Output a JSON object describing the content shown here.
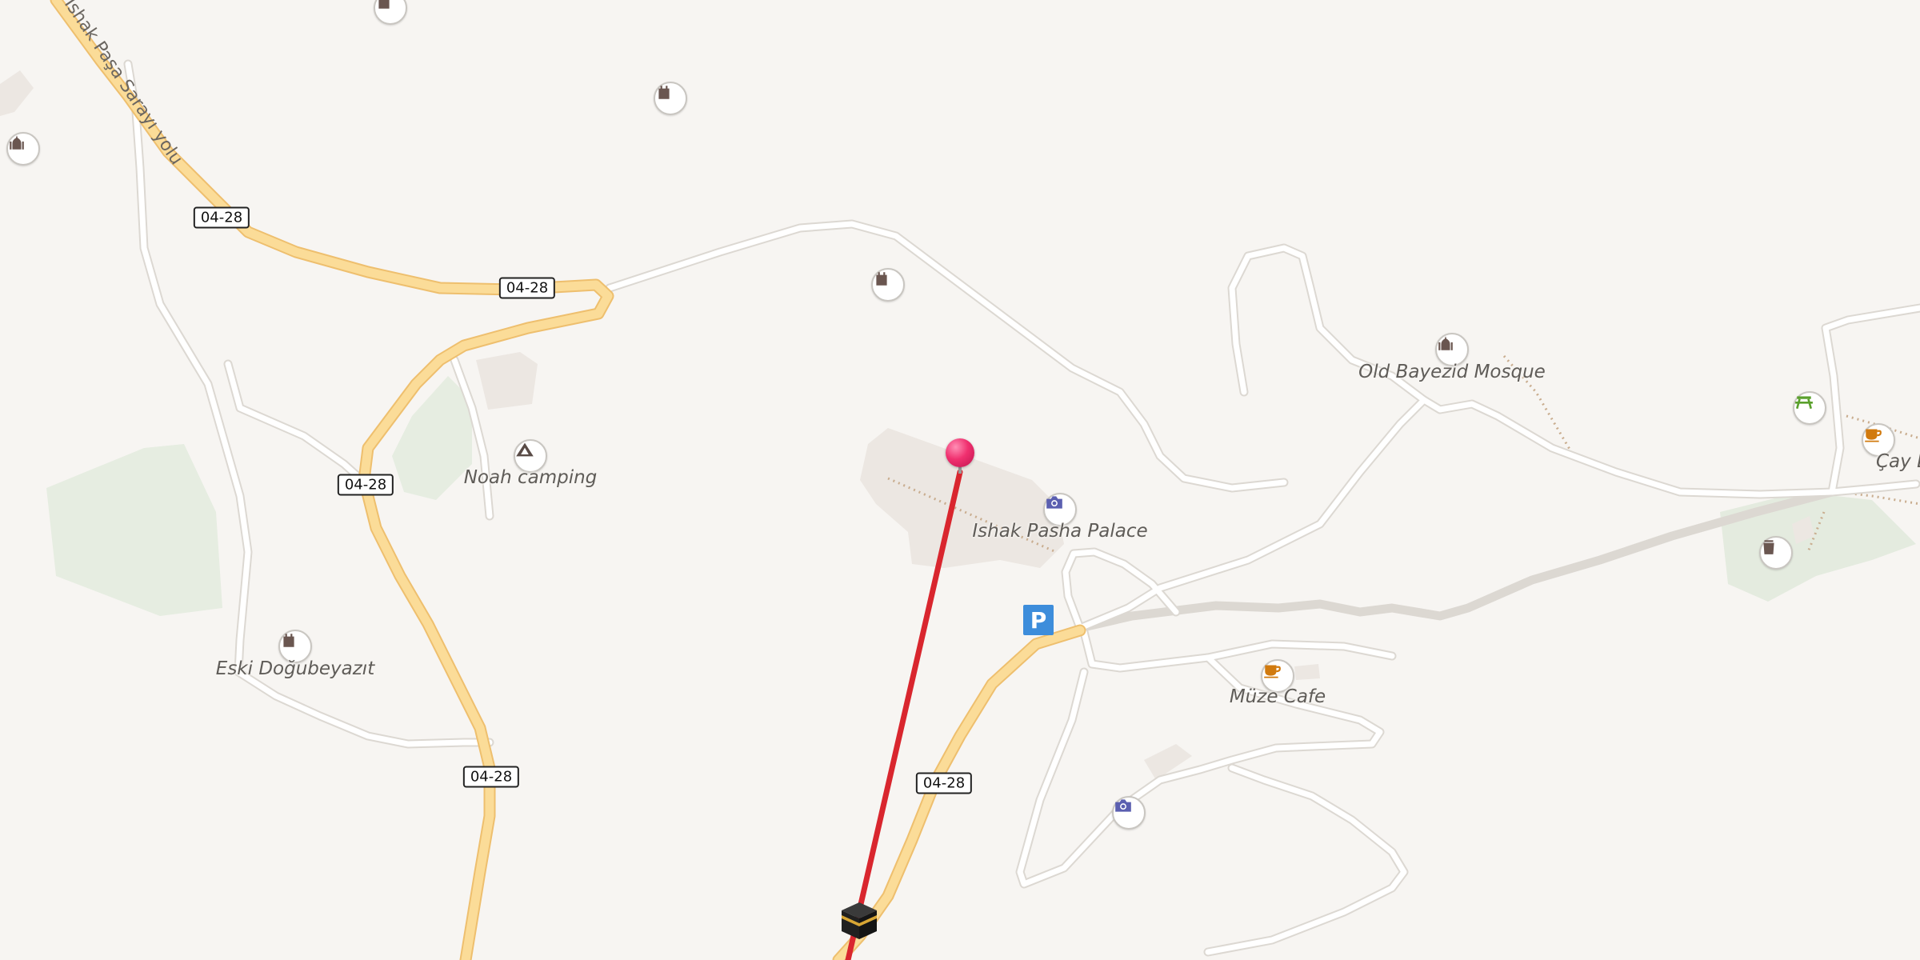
{
  "map": {
    "colors": {
      "background": "#f7f5f2",
      "major_road": "#fbdc98",
      "major_road_casing": "#eebf6e",
      "minor_road": "#ffffff",
      "minor_road_casing": "#dcd8d2",
      "green_area": "#e6ede1",
      "building": "#ece7e2",
      "path": "#c9ad8f",
      "route_line": "#d9262e",
      "pin": "#f0306f"
    },
    "road_name": "İshak Paşa Sarayı yolu",
    "road_refs": [
      "04-28",
      "04-28",
      "04-28",
      "04-28",
      "04-28"
    ],
    "places": [
      {
        "name": "Noah camping",
        "icon": "campsite-icon"
      },
      {
        "name": "Ishak Pasha Palace",
        "icon": "camera-icon"
      },
      {
        "name": "Old Bayezid Mosque",
        "icon": "mosque-icon"
      },
      {
        "name": "Eski Doğubeyazıt",
        "icon": "castle-icon"
      },
      {
        "name": "Müze Cafe",
        "icon": "cafe-icon"
      },
      {
        "name": "Çay Bahçes",
        "icon": "cafe-icon"
      }
    ],
    "unlabeled_icons": [
      "castle-icon",
      "castle-icon",
      "castle-icon",
      "mosque-icon",
      "camera-icon",
      "picnic-icon",
      "waste-basket-icon"
    ],
    "parking_label": "P",
    "marker": {
      "icon": "map-pin-icon",
      "destination_icon": "kaaba-icon"
    }
  }
}
